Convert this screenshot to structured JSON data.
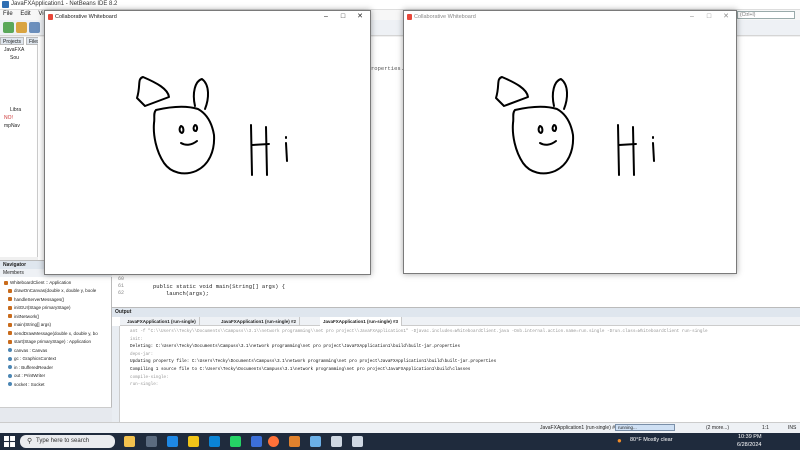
{
  "ide": {
    "title": "JavaFXApplication1 - NetBeans IDE 8.2",
    "menu": [
      "File",
      "Edit",
      "View"
    ],
    "search_placeholder": "(Ctrl+I)",
    "project_tabs": [
      "Projects",
      "Files"
    ],
    "project_tree": [
      "JavaFXA",
      "Sou",
      "Libra",
      "NO!",
      "mpNav"
    ],
    "properties_fragment": "roperties."
  },
  "editor": {
    "line_numbers": [
      "60",
      "61",
      "62"
    ],
    "code": [
      "public static void main(String[] args) {",
      "launch(args);"
    ]
  },
  "navigator": {
    "title": "Navigator",
    "members_label": "Members",
    "root": "WhiteboardClient :: Application",
    "items": [
      "drawOnCanvas(double x, double y, boole",
      "handleServerMessages()",
      "initGUI(Stage primaryStage)",
      "initNetwork()",
      "main(String[] args)",
      "sendDrawMessage(double x, double y, bo",
      "start(Stage primaryStage) : Application",
      "canvas : Canvas",
      "gc : GraphicsContext",
      "in : BufferedReader",
      "out : PrintWriter",
      "socket : Socket"
    ]
  },
  "output": {
    "title": "Output",
    "tabs": [
      "JavaFXApplication1 (run-single)",
      "JavaFXApplication1 (run-single) #2",
      "JavaFXApplication1 (run-single) #3"
    ],
    "lines": [
      {
        "text": "ant -f \"C:\\\\Users\\\\Tecky\\\\Documents\\\\Campuss\\\\3.1\\\\network programming\\\\net pro project\\\\JavaFXApplication1\" -Djavac.includes=WhiteboardClient.java -Dnb.internal.action.name=run.single -Drun.class=WhiteboardClient run-single",
        "dim": true
      },
      {
        "text": "init:",
        "dim": true
      },
      {
        "text": "Deleting: C:\\Users\\Tecky\\Documents\\Campuss\\3.1\\network programming\\net pro project\\JavaFXApplication1\\build\\built-jar.properties",
        "dim": false
      },
      {
        "text": "deps-jar:",
        "dim": true
      },
      {
        "text": "Updating property file: C:\\Users\\Tecky\\Documents\\Campuss\\3.1\\network programming\\net pro project\\JavaFXApplication1\\build\\built-jar.properties",
        "dim": false
      },
      {
        "text": "Compiling 1 source file to C:\\Users\\Tecky\\Documents\\Campuss\\3.1\\network programming\\net pro project\\JavaFXApplication1\\build\\classes",
        "dim": false
      },
      {
        "text": "compile-single:",
        "dim": true
      },
      {
        "text": "run-single:",
        "dim": true
      }
    ]
  },
  "status_bar": {
    "task": "JavaFXApplication1 (run-single) #3",
    "progress_label": "running...",
    "more": "(2 more...)",
    "position": "1:1",
    "mode": "INS"
  },
  "whiteboard_1": {
    "title": "Collaborative Whiteboard",
    "controls": [
      "–",
      "□",
      "✕"
    ]
  },
  "whiteboard_2": {
    "title": "Collaborative Whiteboard",
    "controls": [
      "–",
      "□",
      "✕"
    ]
  },
  "taskbar": {
    "search_placeholder": "Type here to search",
    "weather": "80°F  Mostly clear",
    "time": "10:39 PM",
    "date": "6/28/2024"
  }
}
